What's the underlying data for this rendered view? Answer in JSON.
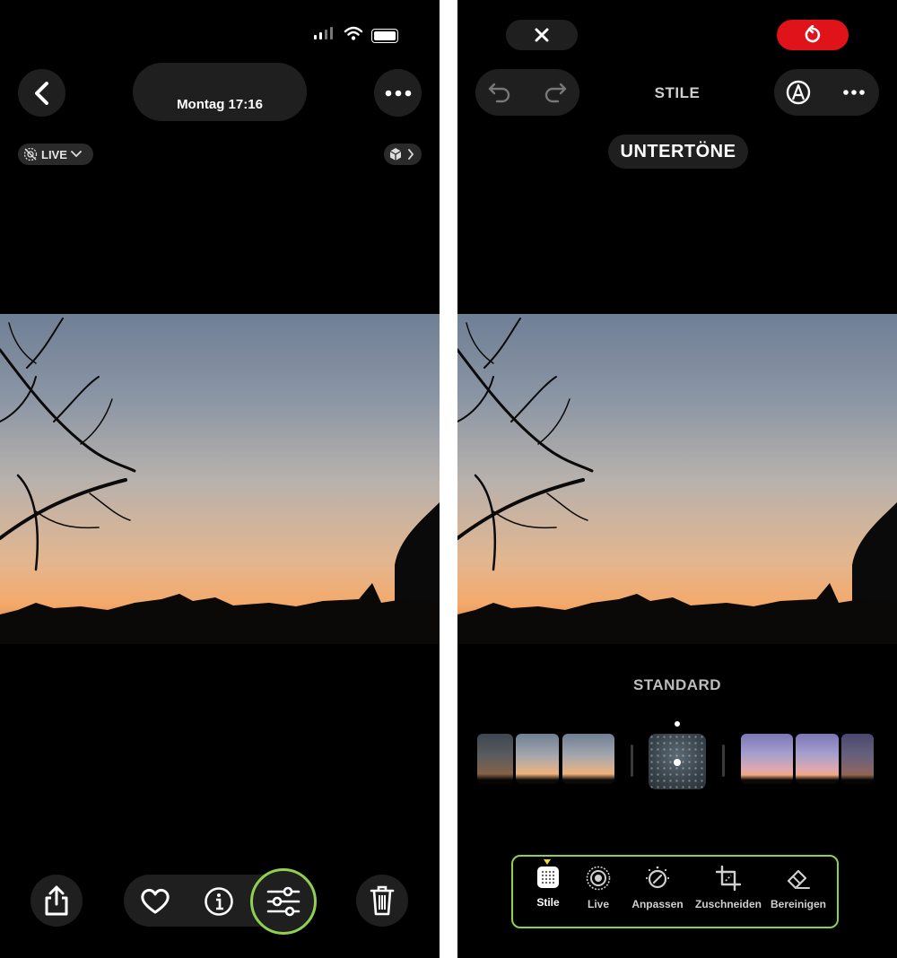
{
  "left": {
    "status": {
      "icons": [
        "signal-icon",
        "wifi-icon",
        "battery-icon"
      ]
    },
    "header": {
      "date_label": "Montag  17:16"
    },
    "live_badge": {
      "label": "LIVE"
    },
    "toolbar": {
      "icons": [
        "share-icon",
        "heart-icon",
        "info-icon",
        "adjust-sliders-icon",
        "trash-icon"
      ]
    }
  },
  "right": {
    "top": {
      "title": "STILE",
      "subtitle": "UNTERTÖNE"
    },
    "style_name": "STANDARD",
    "tools": [
      {
        "label": "Stile",
        "icon": "grid-icon",
        "active": true
      },
      {
        "label": "Live",
        "icon": "live-icon",
        "active": false
      },
      {
        "label": "Anpassen",
        "icon": "dial-icon",
        "active": false
      },
      {
        "label": "Zuschneiden",
        "icon": "crop-icon",
        "active": false
      },
      {
        "label": "Bereinigen",
        "icon": "eraser-icon",
        "active": false
      }
    ]
  },
  "colors": {
    "accent_green": "#8fd14f",
    "revert_red": "#e0121a",
    "selector_yellow": "#f7d33d"
  }
}
